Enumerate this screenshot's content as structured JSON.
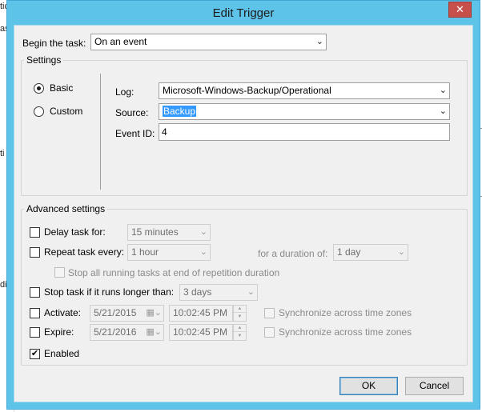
{
  "window": {
    "title": "Edit Trigger",
    "close_glyph": "✕"
  },
  "background": {
    "fragment_1": "tic",
    "fragment_2": "ask",
    "fragment_3": "ti",
    "fragment_4": "di"
  },
  "begin": {
    "label": "Begin the task:",
    "value": "On an event"
  },
  "settings": {
    "group_label": "Settings",
    "radio_basic": "Basic",
    "radio_custom": "Custom",
    "selected": "Basic",
    "log_label": "Log:",
    "log_value": "Microsoft-Windows-Backup/Operational",
    "source_label": "Source:",
    "source_value": "Backup",
    "event_id_label": "Event ID:",
    "event_id_value": "4"
  },
  "advanced": {
    "group_label": "Advanced settings",
    "delay": {
      "label": "Delay task for:",
      "value": "15 minutes",
      "checked": false
    },
    "repeat": {
      "label": "Repeat task every:",
      "value": "1 hour",
      "checked": false,
      "duration_label": "for a duration of:",
      "duration_value": "1 day"
    },
    "stop_all": {
      "label": "Stop all running tasks at end of repetition duration",
      "checked": false
    },
    "stop_if_longer": {
      "label": "Stop task if it runs longer than:",
      "value": "3 days",
      "checked": false
    },
    "activate": {
      "label": "Activate:",
      "date": "5/21/2015",
      "time": "10:02:45 PM",
      "checked": false,
      "sync_label": "Synchronize across time zones"
    },
    "expire": {
      "label": "Expire:",
      "date": "5/21/2016",
      "time": "10:02:45 PM",
      "checked": false,
      "sync_label": "Synchronize across time zones"
    },
    "enabled": {
      "label": "Enabled",
      "checked": true,
      "check_glyph": "✔"
    }
  },
  "buttons": {
    "ok": "OK",
    "cancel": "Cancel"
  },
  "colors": {
    "title_bar": "#5ec3e8",
    "close_button": "#c7504a",
    "selection": "#3399ff",
    "dialog_background": "#f0f0f0"
  }
}
